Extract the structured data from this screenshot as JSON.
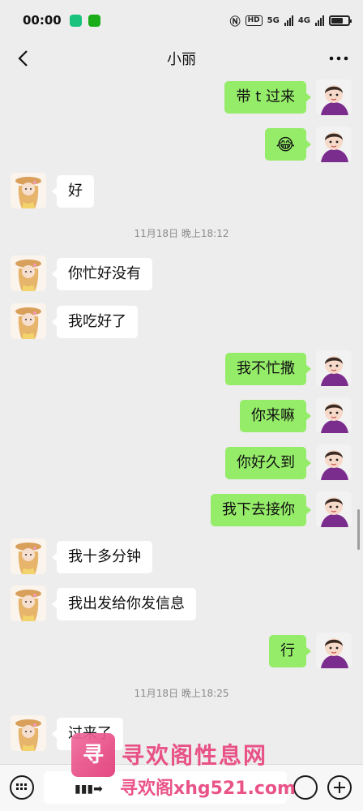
{
  "status_bar": {
    "time": "00:00",
    "hd_label": "HD",
    "net1": "5G",
    "net2": "4G"
  },
  "header": {
    "title": "小丽"
  },
  "messages": [
    {
      "from": "me",
      "text": "带 t 过来"
    },
    {
      "from": "me",
      "text": "😂",
      "kind": "emoji"
    },
    {
      "from": "them",
      "text": "好"
    },
    {
      "kind": "time",
      "text": "11月18日 晚上18:12"
    },
    {
      "from": "them",
      "text": "你忙好没有"
    },
    {
      "from": "them",
      "text": "我吃好了"
    },
    {
      "from": "me",
      "text": "我不忙撒"
    },
    {
      "from": "me",
      "text": "你来嘛"
    },
    {
      "from": "me",
      "text": "你好久到"
    },
    {
      "from": "me",
      "text": "我下去接你"
    },
    {
      "from": "them",
      "text": "我十多分钟"
    },
    {
      "from": "them",
      "text": "我出发给你发信息"
    },
    {
      "from": "me",
      "text": "行"
    },
    {
      "kind": "time",
      "text": "11月18日 晚上18:25"
    },
    {
      "from": "them",
      "text": "过来了"
    }
  ],
  "watermark": {
    "logo_text": "寻欢",
    "title": "寻欢阁性息网",
    "url": "寻欢阁xhg521.com"
  },
  "colors": {
    "background": "#EDEDED",
    "my_bubble": "#95EC69",
    "their_bubble": "#FFFFFF",
    "watermark": "#E8457E"
  }
}
